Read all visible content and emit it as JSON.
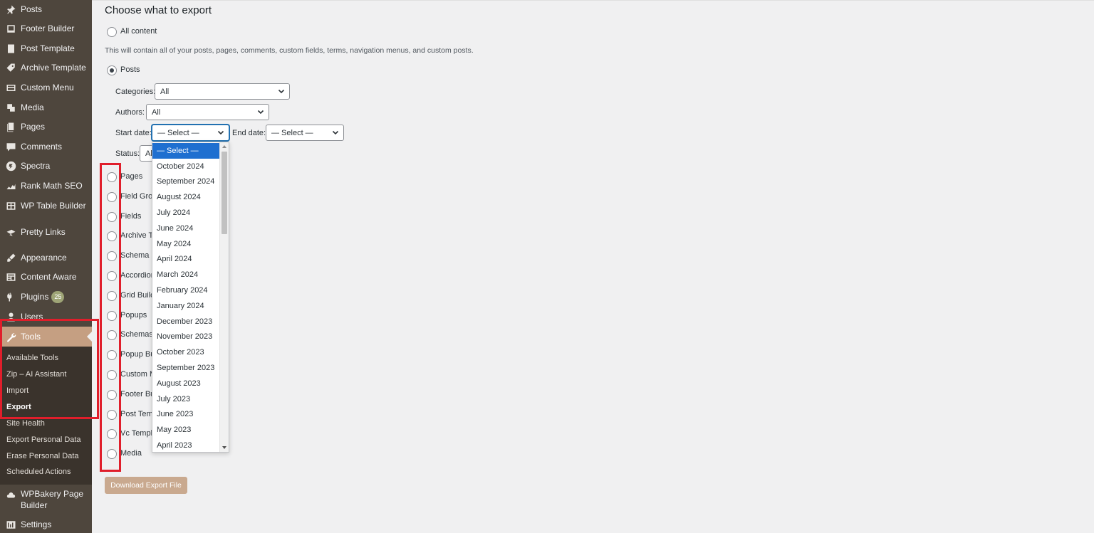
{
  "sidebar": {
    "items": [
      {
        "label": "Posts",
        "icon": "pin-icon"
      },
      {
        "label": "Footer Builder",
        "icon": "footer-icon"
      },
      {
        "label": "Post Template",
        "icon": "template-icon"
      },
      {
        "label": "Archive Template",
        "icon": "tag-icon"
      },
      {
        "label": "Custom Menu",
        "icon": "menu-icon"
      },
      {
        "label": "Media",
        "icon": "media-icon"
      },
      {
        "label": "Pages",
        "icon": "pages-icon"
      },
      {
        "label": "Comments",
        "icon": "comment-icon"
      },
      {
        "label": "Spectra",
        "icon": "spectra-icon"
      },
      {
        "label": "Rank Math SEO",
        "icon": "rankmath-icon"
      },
      {
        "label": "WP Table Builder",
        "icon": "table-icon"
      },
      {
        "label": "Pretty Links",
        "icon": "link-icon"
      },
      {
        "label": "Appearance",
        "icon": "brush-icon"
      },
      {
        "label": "Content Aware",
        "icon": "content-icon"
      },
      {
        "label": "Plugins",
        "icon": "plugin-icon",
        "badge": "25"
      },
      {
        "label": "Users",
        "icon": "user-icon"
      },
      {
        "label": "WPBakery Page Builder",
        "icon": "cloud-icon"
      },
      {
        "label": "Settings",
        "icon": "settings-icon"
      }
    ],
    "tools": {
      "label": "Tools",
      "icon": "wrench-icon"
    },
    "submenu": [
      "Available Tools",
      "Zip – AI Assistant",
      "Import",
      "Export",
      "Site Health",
      "Export Personal Data",
      "Erase Personal Data",
      "Scheduled Actions"
    ],
    "current_submenu": "Export"
  },
  "main": {
    "heading": "Choose what to export",
    "all_content_label": "All content",
    "all_content_desc": "This will contain all of your posts, pages, comments, custom fields, terms, navigation menus, and custom posts.",
    "posts_label": "Posts",
    "filters": {
      "categories_label": "Categories:",
      "categories_value": "All",
      "authors_label": "Authors:",
      "authors_value": "All",
      "start_date_label": "Start date:",
      "start_date_value": "— Select —",
      "end_date_label": "End date:",
      "end_date_value": "— Select —",
      "status_label": "Status:",
      "status_value": "All"
    },
    "post_types": [
      "Pages",
      "Field Grou",
      "Fields",
      "Archive Te",
      "Schema",
      "Accordion",
      "Grid Build",
      "Popups",
      "Schemas",
      "Popup Bu",
      "Custom M",
      "Footer Bu",
      "Post Temp",
      "Vc Templa",
      "Media"
    ],
    "download_button": "Download Export File"
  },
  "dropdown": {
    "options": [
      "— Select —",
      "October 2024",
      "September 2024",
      "August 2024",
      "July 2024",
      "June 2024",
      "May 2024",
      "April 2024",
      "March 2024",
      "February 2024",
      "January 2024",
      "December 2023",
      "November 2023",
      "October 2023",
      "September 2023",
      "August 2023",
      "July 2023",
      "June 2023",
      "May 2023",
      "April 2023"
    ],
    "selected": "— Select —"
  },
  "colors": {
    "sidebar_bg": "#4e463d",
    "active_item_bg": "#c59f82",
    "submenu_bg": "#3a332c",
    "highlight_border": "#e01e2b",
    "dropdown_selected": "#1e6fd0",
    "button_bg": "#c9a98f"
  }
}
